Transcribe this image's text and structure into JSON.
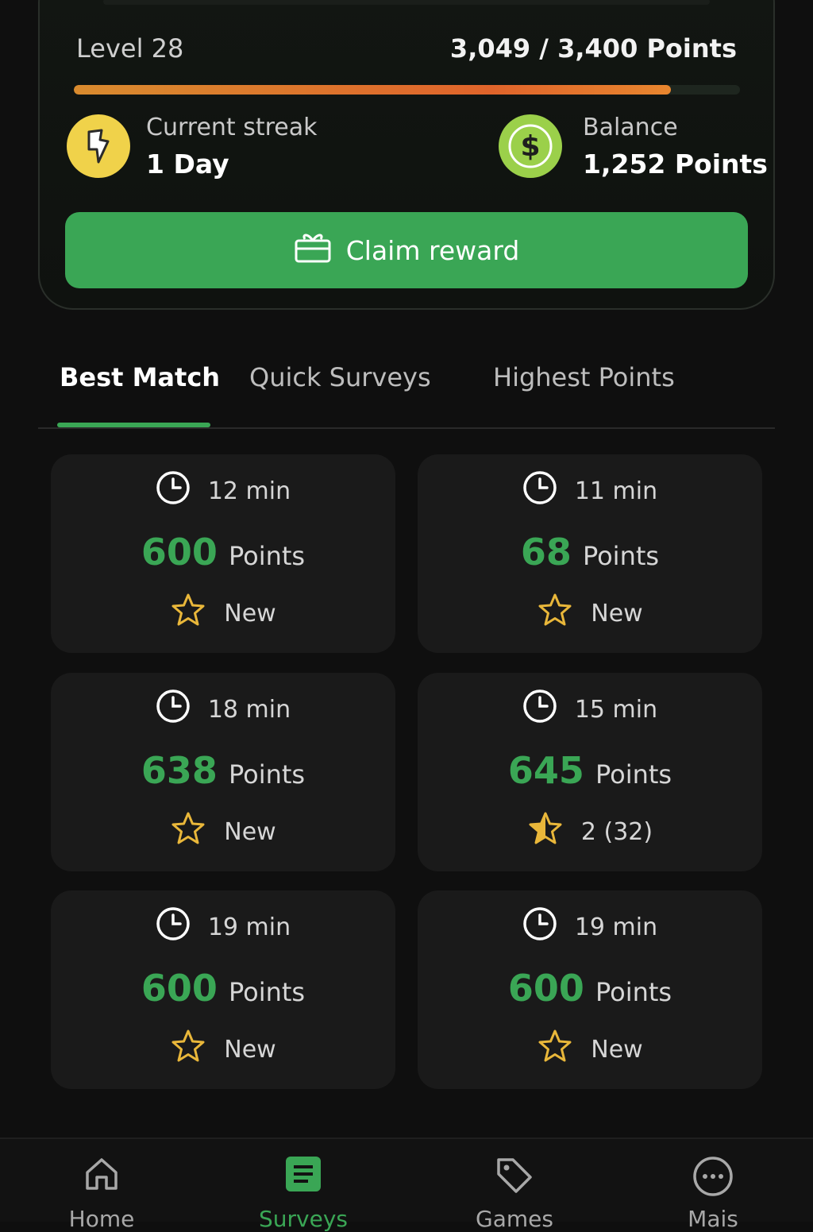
{
  "progress_card": {
    "level_label": "Level 28",
    "points_progress": "3,049 / 3,400 Points",
    "progress_fraction": 0.8968,
    "streak_label": "Current streak",
    "streak_value": "1 Day",
    "balance_label": "Balance",
    "balance_value": "1,252 Points",
    "claim_label": "Claim reward"
  },
  "tabs": [
    {
      "label": "Best Match",
      "active": true
    },
    {
      "label": "Quick Surveys",
      "active": false
    },
    {
      "label": "Highest Points",
      "active": false
    }
  ],
  "surveys": [
    {
      "time": "12 min",
      "points": "600",
      "points_word": "Points",
      "rating": "New",
      "star": "empty"
    },
    {
      "time": "11 min",
      "points": "68",
      "points_word": "Points",
      "rating": "New",
      "star": "empty"
    },
    {
      "time": "18 min",
      "points": "638",
      "points_word": "Points",
      "rating": "New",
      "star": "empty"
    },
    {
      "time": "15 min",
      "points": "645",
      "points_word": "Points",
      "rating": "2 (32)",
      "star": "half"
    },
    {
      "time": "19 min",
      "points": "600",
      "points_word": "Points",
      "rating": "New",
      "star": "empty"
    },
    {
      "time": "19 min",
      "points": "600",
      "points_word": "Points",
      "rating": "New",
      "star": "empty"
    }
  ],
  "nav": [
    {
      "label": "Home",
      "icon": "home-icon",
      "active": false
    },
    {
      "label": "Surveys",
      "icon": "surveys-icon",
      "active": true
    },
    {
      "label": "Games",
      "icon": "tag-icon",
      "active": false
    },
    {
      "label": "Mais",
      "icon": "more-icon",
      "active": false
    }
  ],
  "colors": {
    "accent": "#3aa655",
    "background": "#0f0f0f",
    "card": "#1a1a1a",
    "progress_start": "#d98b2e",
    "progress_end": "#e0642b",
    "star": "#e9b73a",
    "streak_icon_bg": "#f0d24a",
    "balance_icon_bg": "#9bd04a"
  }
}
